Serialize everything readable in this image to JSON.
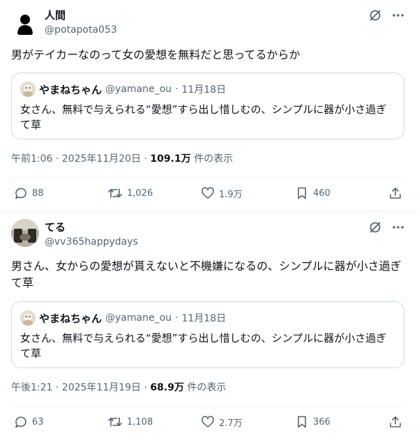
{
  "posts": [
    {
      "name": "人間",
      "handle": "@potapota053",
      "text": "男がテイカーなのって女の愛想を無料だと思ってるからか",
      "quote": {
        "name": "やまねちゃん",
        "handle": "@yamane_ou",
        "date": "11月18日",
        "text": "女さん、無料で与えられる“愛想”すら出し惜しむの、シンプルに器が小さ過ぎて草"
      },
      "timestamp": "午前1:06 · 2025年11月20日 · ",
      "views": "109.1万",
      "views_suffix": " 件の表示",
      "replies": "88",
      "reposts": "1,026",
      "likes": "1.9万",
      "bookmarks": "460"
    },
    {
      "name": "てる",
      "handle": "@vv365happydays",
      "text": "男さん、女からの愛想が貰えないと不機嫌になるの、シンプルに器が小さ過ぎて草",
      "quote": {
        "name": "やまねちゃん",
        "handle": "@yamane_ou",
        "date": "11月18日",
        "text": "女さん、無料で与えられる“愛想”すら出し惜しむの、シンプルに器が小さ過ぎて草"
      },
      "timestamp": "午後1:21 · 2025年11月19日 · ",
      "views": "68.9万",
      "views_suffix": " 件の表示",
      "replies": "63",
      "reposts": "1,108",
      "likes": "2.7万",
      "bookmarks": "366"
    }
  ],
  "icons": {
    "grok": "grok-icon",
    "more": "more-icon",
    "reply": "reply-icon",
    "repost": "repost-icon",
    "like": "like-icon",
    "bookmark": "bookmark-icon",
    "share": "share-icon"
  }
}
